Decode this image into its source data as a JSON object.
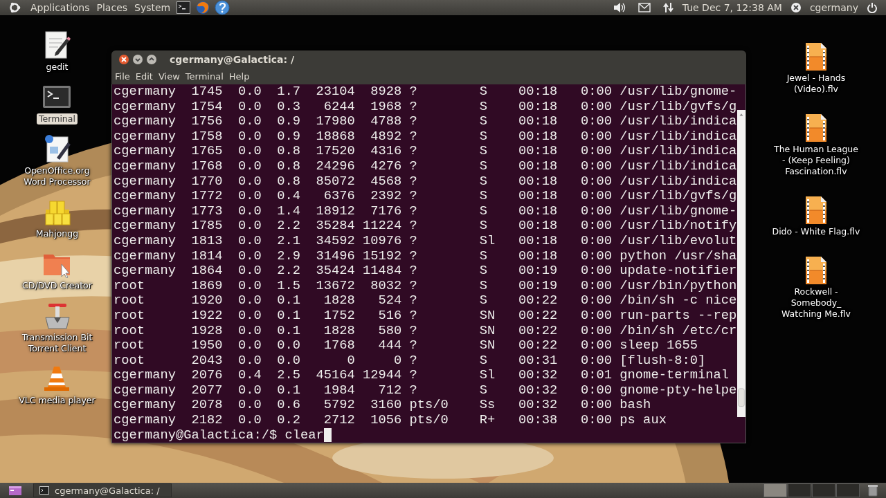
{
  "top_panel": {
    "menus": [
      {
        "label": "Applications"
      },
      {
        "label": "Places"
      },
      {
        "label": "System"
      }
    ],
    "launchers": [
      {
        "kind": "terminal"
      },
      {
        "kind": "browser"
      },
      {
        "kind": "help"
      }
    ],
    "clock": "Tue Dec  7, 12:38 AM",
    "user": "cgermany"
  },
  "desktop_icons_left": [
    {
      "label": "gedit",
      "kind": "editor",
      "selected": false
    },
    {
      "label": "Terminal",
      "kind": "terminal",
      "selected": true
    },
    {
      "label": "OpenOffice.org\nWord Processor",
      "kind": "writer",
      "selected": false
    },
    {
      "label": "Mahjongg",
      "kind": "tiles",
      "selected": false
    },
    {
      "label": "CD/DVD Creator",
      "kind": "folder",
      "selected": false
    },
    {
      "label": "Transmission Bit\nTorrent Client",
      "kind": "torrent",
      "selected": false
    },
    {
      "label": "VLC media player",
      "kind": "cone",
      "selected": false
    }
  ],
  "desktop_icons_right": [
    {
      "label": "Jewel - Hands\n(Video).flv",
      "kind": "video"
    },
    {
      "label": "The Human League\n- (Keep Feeling)\nFascination.flv",
      "kind": "video"
    },
    {
      "label": "Dido - White Flag.flv",
      "kind": "video"
    },
    {
      "label": "Rockwell -\nSomebody_\nWatching Me.flv",
      "kind": "video"
    }
  ],
  "terminal_window": {
    "title": "cgermany@Galactica: /",
    "menus": [
      {
        "label": "File"
      },
      {
        "label": "Edit"
      },
      {
        "label": "View"
      },
      {
        "label": "Terminal"
      },
      {
        "label": "Help"
      }
    ],
    "lines": [
      "cgermany  1745  0.0  1.7  23104  8928 ?        S    00:18   0:00 /usr/lib/gnome-",
      "cgermany  1754  0.0  0.3   6244  1968 ?        S    00:18   0:00 /usr/lib/gvfs/g",
      "cgermany  1756  0.0  0.9  17980  4788 ?        S    00:18   0:00 /usr/lib/indica",
      "cgermany  1758  0.0  0.9  18868  4892 ?        S    00:18   0:00 /usr/lib/indica",
      "cgermany  1765  0.0  0.8  17520  4316 ?        S    00:18   0:00 /usr/lib/indica",
      "cgermany  1768  0.0  0.8  24296  4276 ?        S    00:18   0:00 /usr/lib/indica",
      "cgermany  1770  0.0  0.8  85072  4568 ?        S    00:18   0:00 /usr/lib/indica",
      "cgermany  1772  0.0  0.4   6376  2392 ?        S    00:18   0:00 /usr/lib/gvfs/g",
      "cgermany  1773  0.0  1.4  18912  7176 ?        S    00:18   0:00 /usr/lib/gnome-",
      "cgermany  1785  0.0  2.2  35284 11224 ?        S    00:18   0:00 /usr/lib/notify",
      "cgermany  1813  0.0  2.1  34592 10976 ?        Sl   00:18   0:00 /usr/lib/evolut",
      "cgermany  1814  0.0  2.9  31496 15192 ?        S    00:18   0:00 python /usr/sha",
      "cgermany  1864  0.0  2.2  35424 11484 ?        S    00:19   0:00 update-notifier",
      "root      1869  0.0  1.5  13672  8032 ?        S    00:19   0:00 /usr/bin/python",
      "root      1920  0.0  0.1   1828   524 ?        S    00:22   0:00 /bin/sh -c nice",
      "root      1922  0.0  0.1   1752   516 ?        SN   00:22   0:00 run-parts --rep",
      "root      1928  0.0  0.1   1828   580 ?        SN   00:22   0:00 /bin/sh /etc/cr",
      "root      1950  0.0  0.0   1768   444 ?        SN   00:22   0:00 sleep 1655",
      "root      2043  0.0  0.0      0     0 ?        S    00:31   0:00 [flush-8:0]",
      "cgermany  2076  0.4  2.5  45164 12944 ?        Sl   00:32   0:01 gnome-terminal",
      "cgermany  2077  0.0  0.1   1984   712 ?        S    00:32   0:00 gnome-pty-helpe",
      "cgermany  2078  0.0  0.6   5792  3160 pts/0    Ss   00:32   0:00 bash",
      "cgermany  2182  0.0  0.2   2712  1056 pts/0    R+   00:38   0:00 ps aux"
    ],
    "prompt": "cgermany@Galactica:/$ clear"
  },
  "taskbar": {
    "tasks": [
      {
        "label": "cgermany@Galactica: /",
        "selected": false
      }
    ],
    "workspaces": [
      {
        "selected": true
      },
      {
        "selected": false
      },
      {
        "selected": false
      },
      {
        "selected": false
      }
    ]
  }
}
